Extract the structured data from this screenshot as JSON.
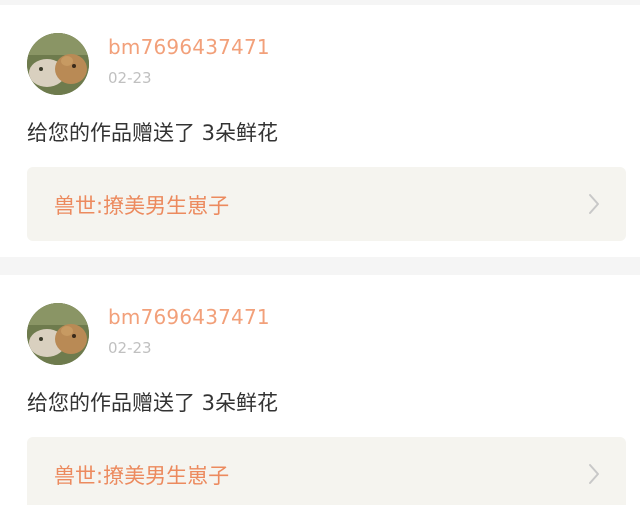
{
  "notifications": [
    {
      "username": "bm7696437471",
      "date": "02-23",
      "message": "给您的作品赠送了 3朵鲜花",
      "work_title": "兽世:撩美男生崽子",
      "icons": {
        "avatar": "avatar",
        "chevron": "chevron-right-icon"
      }
    },
    {
      "username": "bm7696437471",
      "date": "02-23",
      "message": "给您的作品赠送了 3朵鲜花",
      "work_title": "兽世:撩美男生崽子",
      "icons": {
        "avatar": "avatar",
        "chevron": "chevron-right-icon"
      }
    }
  ],
  "colors": {
    "username": "#f2a07a",
    "work_title": "#ec8a5e",
    "message": "#333333",
    "date": "#c0c0c0",
    "link_bg": "#f5f4ef",
    "page_bg": "#f5f5f5"
  }
}
